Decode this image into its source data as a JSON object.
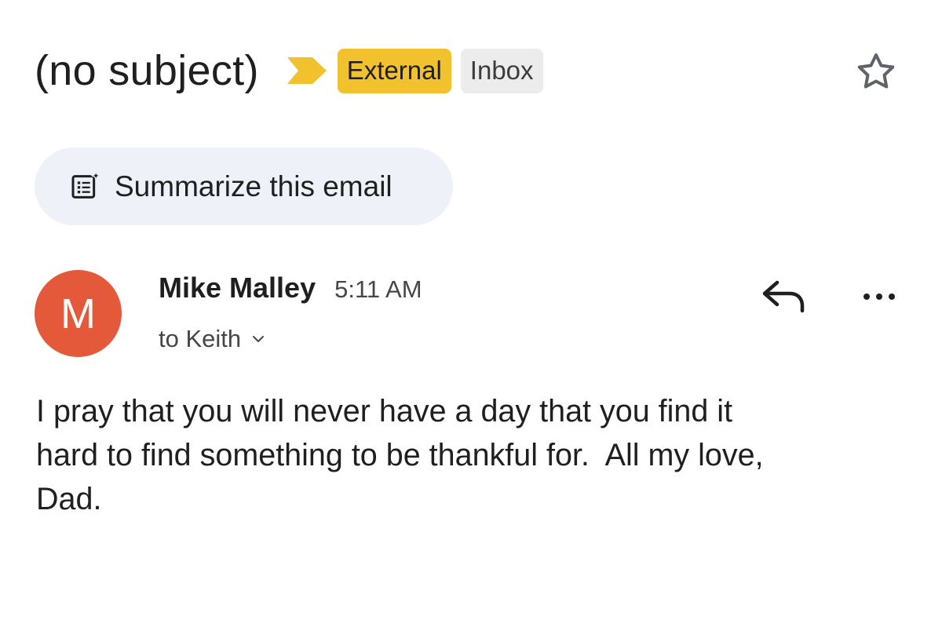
{
  "message": {
    "subject": "(no subject)",
    "labels": {
      "external": "External",
      "inbox": "Inbox"
    },
    "importance_icon": "importance-marker-icon",
    "star_icon": "star-outline-icon"
  },
  "summarize": {
    "icon": "summarize-list-sparkle-icon",
    "label": "Summarize this email"
  },
  "sender": {
    "avatar_letter": "M",
    "name": "Mike Malley",
    "time": "5:11 AM",
    "recipient": "to Keith",
    "expand_icon": "chevron-down-icon",
    "reply_icon": "reply-icon",
    "more_icon": "more-horizontal-icon"
  },
  "body": {
    "lines": [
      "I pray that you will never have a day that you find it",
      "hard to find something to be thankful for.  All my love,",
      "Dad."
    ]
  },
  "colors": {
    "avatar": "#e4593a",
    "external_label": "#f2c12e",
    "importance_marker": "#f2c12e",
    "inbox_label": "#ececec",
    "summarize_chip": "#eef2f8"
  }
}
